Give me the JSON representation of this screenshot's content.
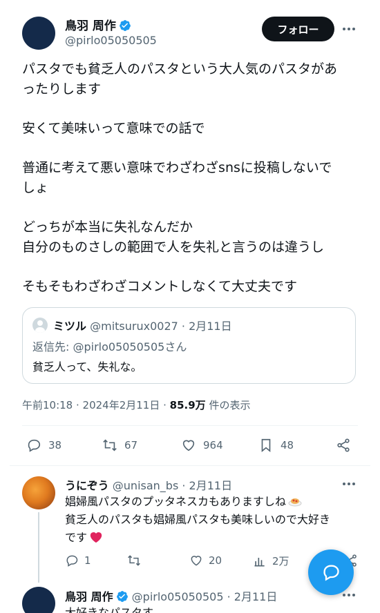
{
  "tweet": {
    "author_name": "鳥羽 周作",
    "handle": "@pirlo05050505",
    "follow_label": "フォロー",
    "lines": [
      "パスタでも貧乏人のパスタという大人気のパスタがあ",
      "ったりします",
      "",
      "安くて美味いって意味での話で",
      "",
      "普通に考えて悪い意味でわざわざsnsに投稿しないで",
      "しょ",
      "",
      "どっちが本当に失礼なんだか",
      "自分のものさしの範囲で人を失礼と言うのは違うし",
      "",
      "そもそもわざわざコメントしなくて大丈夫です"
    ],
    "quote": {
      "name": "ミツル",
      "handle": "@mitsurux0027",
      "date": "· 2月11日",
      "reply_to": "返信先: @pirlo05050505さん",
      "text": "貧乏人って、失礼な。"
    },
    "meta_time": "午前10:18 · 2024年2月11日 ·",
    "meta_views": "85.9万",
    "meta_views_suffix": "件の表示",
    "actions": {
      "replies": "38",
      "retweets": "67",
      "likes": "964",
      "bookmarks": "48"
    }
  },
  "reply": {
    "name": "うにぞう",
    "handle": "@unisan_bs",
    "date": "· 2月11日",
    "line1": "娼婦風パスタのプッタネスカもありますしね",
    "line2": "貧乏人のパスタも娼婦風パスタも美味しいので大好き",
    "line3": "です",
    "actions": {
      "replies": "1",
      "retweets": "",
      "likes": "20",
      "views": "2万"
    }
  },
  "reply2": {
    "name": "鳥羽 周作",
    "handle": "@pirlo05050505",
    "date": "· 2月11日",
    "text": "大好きなパスタす"
  },
  "colors": {
    "accent": "#1d9bf0",
    "follow_bg": "#0f1419",
    "heart_red": "#e0245e"
  }
}
